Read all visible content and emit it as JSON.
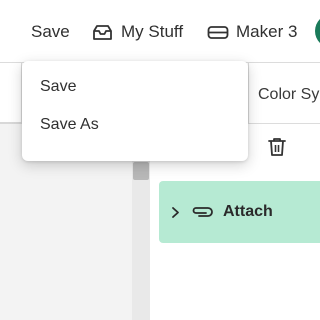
{
  "toolbar": {
    "save_label": "Save",
    "my_stuff_label": "My Stuff",
    "machine_label": "Maker 3",
    "my_stuff_icon": "inbox-tray-icon",
    "machine_icon": "cutting-machine-icon"
  },
  "panel": {
    "color_sync_label": "Color Sy",
    "delete_icon": "trash-icon"
  },
  "layers": {
    "items": [
      {
        "label": "Attach",
        "icon": "paperclip-icon",
        "expander_icon": "chevron-right-icon",
        "highlight_color": "#b6ead3"
      }
    ]
  },
  "save_menu": {
    "items": [
      {
        "label": "Save"
      },
      {
        "label": "Save As"
      }
    ]
  },
  "colors": {
    "accent_green": "#1a7a5a",
    "selected_layer_bg": "#b6ead3"
  }
}
